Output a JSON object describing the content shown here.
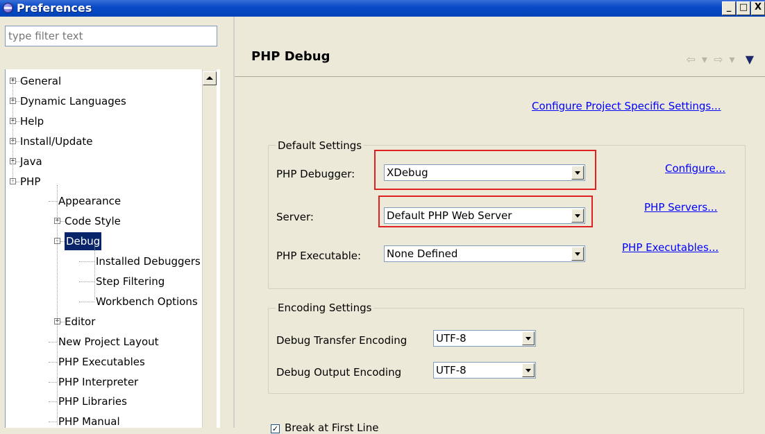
{
  "window": {
    "title": "Preferences",
    "controls": {
      "minimize": "_",
      "maximize": "□",
      "close": "X"
    }
  },
  "sidebar": {
    "filter_placeholder": "type filter text",
    "tree": [
      {
        "label": "General",
        "expander": "+",
        "level": 0
      },
      {
        "label": "Dynamic Languages",
        "expander": "+",
        "level": 0
      },
      {
        "label": "Help",
        "expander": "+",
        "level": 0
      },
      {
        "label": "Install/Update",
        "expander": "+",
        "level": 0
      },
      {
        "label": "Java",
        "expander": "+",
        "level": 0
      },
      {
        "label": "PHP",
        "expander": "-",
        "level": 0
      },
      {
        "label": "Appearance",
        "level": 1
      },
      {
        "label": "Code Style",
        "expander": "+",
        "level": 1
      },
      {
        "label": "Debug",
        "expander": "-",
        "level": 1,
        "selected": true
      },
      {
        "label": "Installed Debuggers",
        "level": 2
      },
      {
        "label": "Step Filtering",
        "level": 2
      },
      {
        "label": "Workbench Options",
        "level": 2
      },
      {
        "label": "Editor",
        "expander": "+",
        "level": 1
      },
      {
        "label": "New Project Layout",
        "level": 1
      },
      {
        "label": "PHP Executables",
        "level": 1
      },
      {
        "label": "PHP Interpreter",
        "level": 1
      },
      {
        "label": "PHP Libraries",
        "level": 1
      },
      {
        "label": "PHP Manual",
        "level": 1
      }
    ]
  },
  "main": {
    "title": "PHP Debug",
    "nav": {
      "back": "⇦ ▾",
      "forward": "⇨ ▾",
      "menu": "▼"
    },
    "project_settings_link": "Configure Project Specific Settings...",
    "default_settings": {
      "legend": "Default Settings",
      "debugger_label": "PHP Debugger:",
      "debugger_value": "XDebug",
      "debugger_link": "Configure...",
      "server_label": "Server:",
      "server_value": "Default PHP Web Server",
      "server_link": "PHP Servers...",
      "executable_label": "PHP Executable:",
      "executable_value": "None Defined",
      "executable_link": "PHP Executables..."
    },
    "encoding_settings": {
      "legend": "Encoding Settings",
      "transfer_label": "Debug Transfer Encoding",
      "transfer_value": "UTF-8",
      "output_label": "Debug Output Encoding",
      "output_value": "UTF-8"
    },
    "break_first_line": {
      "label": "Break at First Line",
      "checked": true
    }
  },
  "colors": {
    "highlight": "#e02020",
    "selection": "#0a246a",
    "link": "#0000ff"
  }
}
